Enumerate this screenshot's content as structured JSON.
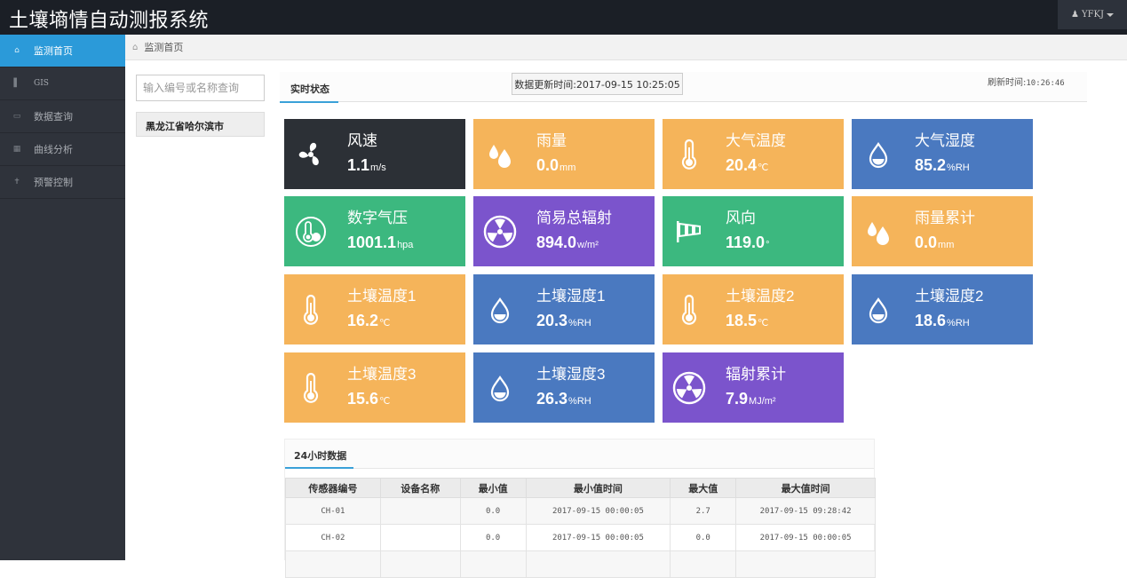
{
  "app": {
    "title": "土壤墒情自动测报系统"
  },
  "user": {
    "name": "YFKJ"
  },
  "sidebar": {
    "items": [
      {
        "label": "监测首页",
        "icon": "home-icon",
        "active": true
      },
      {
        "label": "GIS",
        "icon": "signal-icon",
        "active": false
      },
      {
        "label": "数据查询",
        "icon": "drive-icon",
        "active": false
      },
      {
        "label": "曲线分析",
        "icon": "grid-icon",
        "active": false
      },
      {
        "label": "预警控制",
        "icon": "crosshair-icon",
        "active": false
      }
    ]
  },
  "breadcrumb": {
    "label": "监测首页"
  },
  "search": {
    "placeholder": "输入编号或名称查询"
  },
  "region": {
    "label": "黑龙江省哈尔滨市"
  },
  "realtime": {
    "tab_label": "实时状态",
    "update_text": "数据更新时间:2017-09-15 10:25:05",
    "refresh_label": "刷新时间:",
    "refresh_time": "10:26:46"
  },
  "tiles": [
    {
      "name": "风速",
      "value": "1.1",
      "unit": "m/s",
      "color": "#2c3036",
      "icon": "fan-icon"
    },
    {
      "name": "雨量",
      "value": "0.0",
      "unit": "mm",
      "color": "#f5b45a",
      "icon": "raindrops-icon"
    },
    {
      "name": "大气温度",
      "value": "20.4",
      "unit": "℃",
      "color": "#f5b45a",
      "icon": "thermometer-icon"
    },
    {
      "name": "大气湿度",
      "value": "85.2",
      "unit": "%RH",
      "color": "#4a79c0",
      "icon": "water-drop-icon"
    },
    {
      "name": "数字气压",
      "value": "1001.1",
      "unit": "hpa",
      "color": "#3cb87f",
      "icon": "barometer-icon"
    },
    {
      "name": "简易总辐射",
      "value": "894.0",
      "unit": "w/m²",
      "color": "#7b54cc",
      "icon": "radiation-icon"
    },
    {
      "name": "风向",
      "value": "119.0",
      "unit": "°",
      "color": "#3cb87f",
      "icon": "windsock-icon"
    },
    {
      "name": "雨量累计",
      "value": "0.0",
      "unit": "mm",
      "color": "#f5b45a",
      "icon": "raindrops-icon"
    },
    {
      "name": "土壤温度1",
      "value": "16.2",
      "unit": "℃",
      "color": "#f5b45a",
      "icon": "thermometer-icon"
    },
    {
      "name": "土壤湿度1",
      "value": "20.3",
      "unit": "%RH",
      "color": "#4a79c0",
      "icon": "water-drop-icon"
    },
    {
      "name": "土壤温度2",
      "value": "18.5",
      "unit": "℃",
      "color": "#f5b45a",
      "icon": "thermometer-icon"
    },
    {
      "name": "土壤湿度2",
      "value": "18.6",
      "unit": "%RH",
      "color": "#4a79c0",
      "icon": "water-drop-icon"
    },
    {
      "name": "土壤温度3",
      "value": "15.6",
      "unit": "℃",
      "color": "#f5b45a",
      "icon": "thermometer-icon"
    },
    {
      "name": "土壤湿度3",
      "value": "26.3",
      "unit": "%RH",
      "color": "#4a79c0",
      "icon": "water-drop-icon"
    },
    {
      "name": "辐射累计",
      "value": "7.9",
      "unit": "MJ/m²",
      "color": "#7b54cc",
      "icon": "radiation-icon"
    }
  ],
  "data24h": {
    "tab_label": "24小时数据",
    "headers": [
      "传感器编号",
      "设备名称",
      "最小值",
      "最小值时间",
      "最大值",
      "最大值时间"
    ],
    "rows": [
      [
        "CH-01",
        "",
        "0.0",
        "2017-09-15 00:00:05",
        "2.7",
        "2017-09-15 09:28:42"
      ],
      [
        "CH-02",
        "",
        "0.0",
        "2017-09-15 00:00:05",
        "0.0",
        "2017-09-15 00:00:05"
      ]
    ]
  }
}
